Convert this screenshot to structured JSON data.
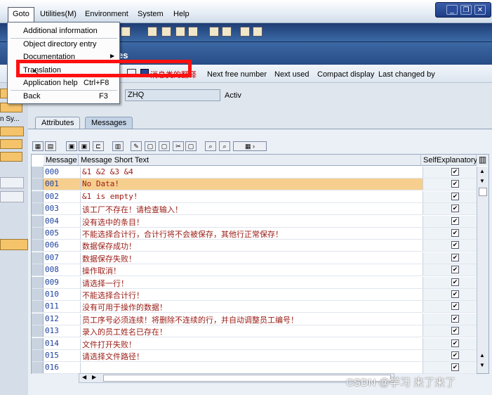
{
  "menubar": {
    "items": [
      "Goto",
      "Utilities(M)",
      "Environment",
      "System",
      "Help"
    ]
  },
  "title": {
    "suffix": "es"
  },
  "app_toolbar": {
    "chinese_label": "消息类的翻译",
    "buttons": [
      "Next free number",
      "Next used",
      "Compact display",
      "Last changed by"
    ]
  },
  "left_strip": {
    "partial_label": "n Sy..."
  },
  "fields": {
    "message_class": "ZHQ",
    "status": "Activ"
  },
  "tabs": [
    "Attributes",
    "Messages"
  ],
  "table": {
    "headers": {
      "message": "Message",
      "short_text": "Message Short Text",
      "self_explanatory": "SelfExplanatory"
    },
    "rows": [
      {
        "num": "000",
        "text": "&1 &2 &3 &4",
        "checked": true
      },
      {
        "num": "001",
        "text": "No Data!",
        "checked": true
      },
      {
        "num": "002",
        "text": "&1 is empty!",
        "checked": true
      },
      {
        "num": "003",
        "text": "该工厂不存在！请检查输入！",
        "checked": true
      },
      {
        "num": "004",
        "text": "没有选中的条目！",
        "checked": true
      },
      {
        "num": "005",
        "text": "不能选择合计行，合计行将不会被保存，其他行正常保存！",
        "checked": true
      },
      {
        "num": "006",
        "text": "数据保存成功！",
        "checked": true
      },
      {
        "num": "007",
        "text": "数据保存失败！",
        "checked": true
      },
      {
        "num": "008",
        "text": "操作取消！",
        "checked": true
      },
      {
        "num": "009",
        "text": "请选择一行！",
        "checked": true
      },
      {
        "num": "010",
        "text": "不能选择合计行！",
        "checked": true
      },
      {
        "num": "011",
        "text": "没有可用于操作的数据！",
        "checked": true
      },
      {
        "num": "012",
        "text": "员工序号必须连续！将删除不连续的行，并自动调整员工编号！",
        "checked": true
      },
      {
        "num": "013",
        "text": "录入的员工姓名已存在！",
        "checked": true
      },
      {
        "num": "014",
        "text": "文件打开失败！",
        "checked": true
      },
      {
        "num": "015",
        "text": "请选择文件路径！",
        "checked": true
      },
      {
        "num": "016",
        "text": "",
        "checked": true
      }
    ],
    "highlighted_row": "001"
  },
  "dropdown": {
    "items": [
      {
        "label": "Additional information",
        "shortcut": ""
      },
      {
        "label": "Object directory entry",
        "shortcut": ""
      },
      {
        "label": "Documentation",
        "shortcut": ""
      },
      {
        "label": "Translation",
        "shortcut": ""
      },
      {
        "label": "Application help",
        "shortcut": "Ctrl+F8"
      },
      {
        "label": "Back",
        "shortcut": "F3"
      }
    ]
  },
  "watermarks": {
    "bottom": "CSDN @学习 来了来了"
  },
  "colors": {
    "title_bar": "#274c86",
    "highlight_row": "#f6cf8e",
    "message_text": "#9a1b14",
    "number_text": "#1c41a0",
    "annotation_box": "#ff1010"
  }
}
